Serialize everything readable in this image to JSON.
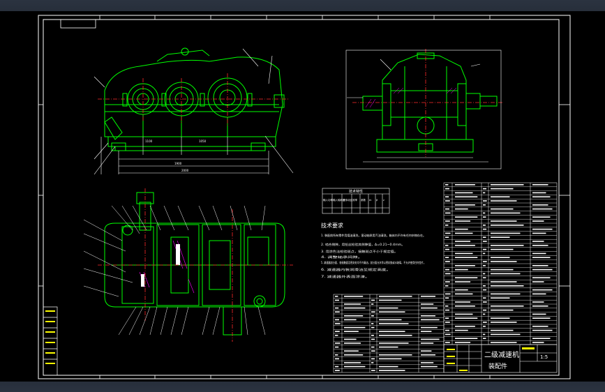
{
  "drawing": {
    "title_block_name": "二级减速机",
    "title_block_sub": "装配件",
    "scale": "1:5",
    "char_table_title": "技术特性",
    "char_table_headers": [
      "输入功率",
      "输入轴转速",
      "总传动比",
      "效率",
      "参数",
      "m",
      "β",
      "z"
    ],
    "tech_title": "技术要求",
    "tech_lines": [
      "1. 装配前所有零件用煤油清洗，滚动轴承用汽油清洗，箱体内不许有任何杂物存在。",
      "2. 啮合侧隙，用铅丝检验其侧隙值，Δ=0.21~0.4mm。",
      "3. 用涂色法检验斑点，接触斑点不小于规定值。",
      "4. 调整轴承间隙。",
      "5. 减速器剖分面、各接触面及密封处均不许漏油，剖分面允许涂以密封胶或水玻璃，不允许使用任何垫片。",
      "6. 减速器内装润滑油至规定高度。",
      "7. 减速器外表面涂漆。"
    ]
  },
  "colors": {
    "background": "#000000",
    "frame": "#ffffff",
    "part": "#00ff00",
    "center": "#ff2a2a",
    "dims": "#ffffff",
    "yellow": "#ffff00",
    "cyan": "#00e5ff",
    "magenta": "#ff00ff",
    "orange": "#ffa500"
  }
}
